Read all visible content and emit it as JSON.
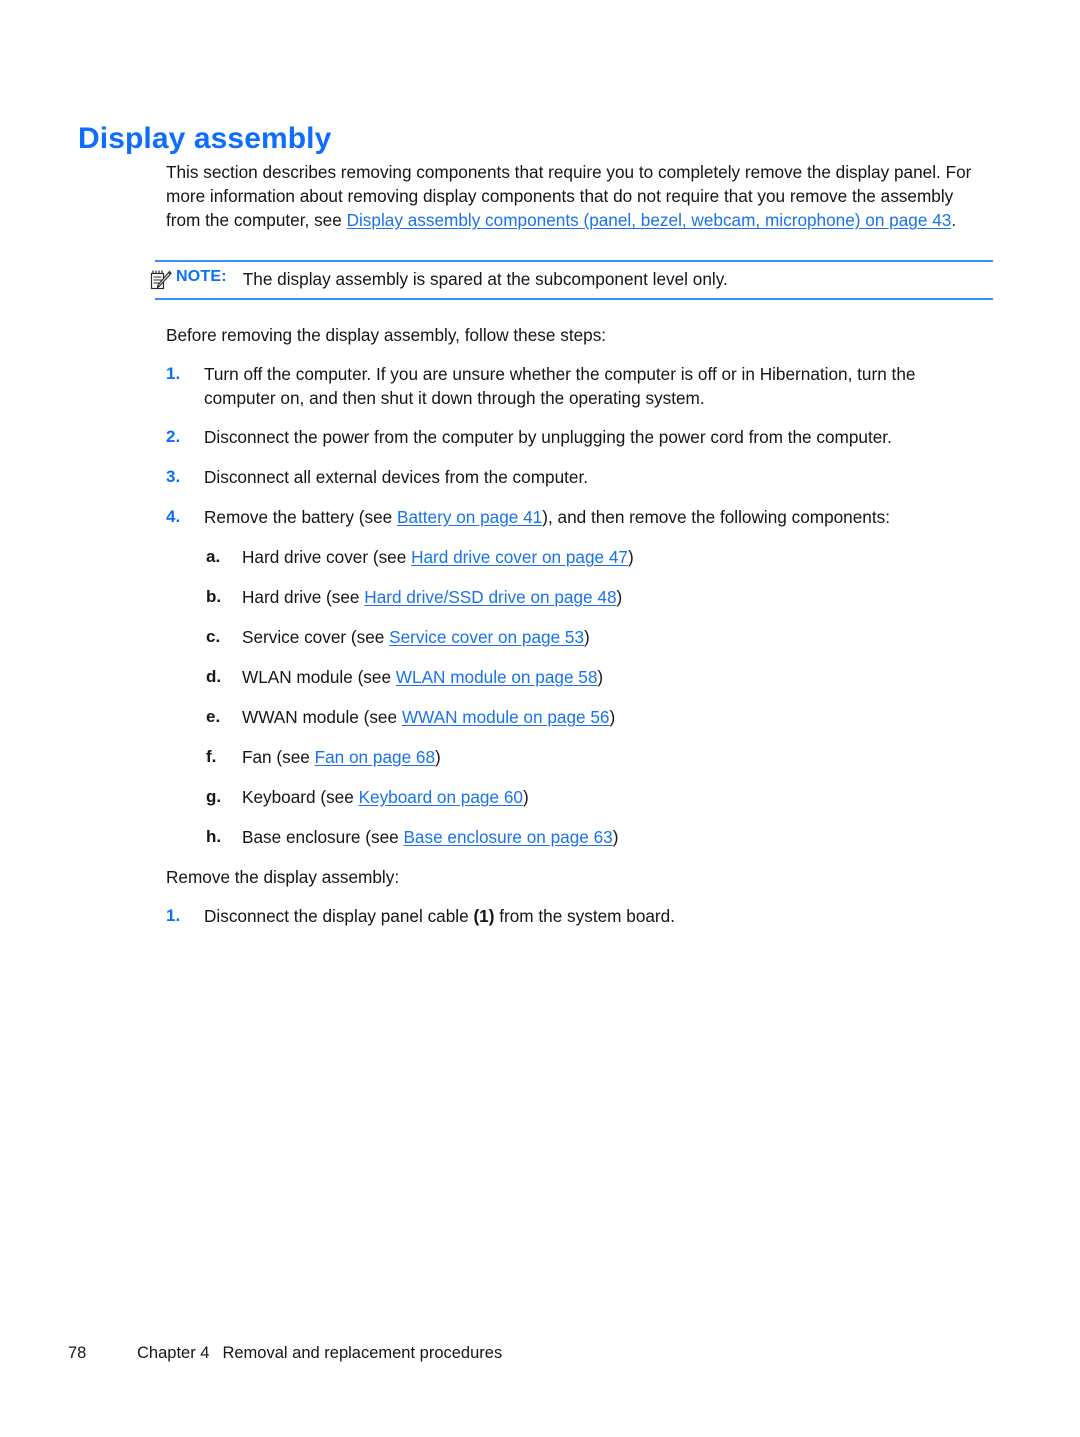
{
  "heading": "Display assembly",
  "colors": {
    "heading_blue": "#0d6efd",
    "link_blue": "#1a73e8",
    "rule_blue": "#3b8ef5",
    "body_black": "#161616"
  },
  "intro": {
    "text_part1": "This section describes removing components that require you to completely remove the display panel. For more information about removing display components that do not require that you remove the assembly from the computer, see ",
    "link": "Display assembly components (panel, bezel, webcam, microphone) on page 43",
    "text_part2": "."
  },
  "note": {
    "icon": "note-pencil-icon",
    "label": "NOTE:",
    "text": "The display assembly is spared at the subcomponent level only."
  },
  "before_lead": "Before removing the display assembly, follow these steps:",
  "steps": [
    {
      "num": "1.",
      "text": "Turn off the computer. If you are unsure whether the computer is off or in Hibernation, turn the computer on, and then shut it down through the operating system."
    },
    {
      "num": "2.",
      "text": "Disconnect the power from the computer by unplugging the power cord from the computer."
    },
    {
      "num": "3.",
      "text": "Disconnect all external devices from the computer."
    },
    {
      "num": "4.",
      "text_pre": "Remove the battery (see ",
      "link": "Battery on page 41",
      "text_post": "), and then remove the following components:"
    }
  ],
  "substeps": [
    {
      "letter": "a.",
      "text_pre": "Hard drive cover (see ",
      "link": "Hard drive cover on page 47",
      "text_post": ")"
    },
    {
      "letter": "b.",
      "text_pre": "Hard drive (see ",
      "link": "Hard drive/SSD drive on page 48",
      "text_post": ")"
    },
    {
      "letter": "c.",
      "text_pre": "Service cover (see ",
      "link": "Service cover on page 53",
      "text_post": ")"
    },
    {
      "letter": "d.",
      "text_pre": "WLAN module (see ",
      "link": "WLAN module on page 58",
      "text_post": ")"
    },
    {
      "letter": "e.",
      "text_pre": "WWAN module (see ",
      "link": "WWAN module on page 56",
      "text_post": ")"
    },
    {
      "letter": "f.",
      "text_pre": "Fan (see ",
      "link": "Fan on page 68",
      "text_post": ")"
    },
    {
      "letter": "g.",
      "text_pre": "Keyboard (see ",
      "link": "Keyboard on page 60",
      "text_post": ")"
    },
    {
      "letter": "h.",
      "text_pre": "Base enclosure (see ",
      "link": "Base enclosure on page 63",
      "text_post": ")"
    }
  ],
  "remove_lead": "Remove the display assembly:",
  "final_step": {
    "num": "1.",
    "text_pre": "Disconnect the display panel cable ",
    "callout": "(1)",
    "text_post": " from the system board."
  },
  "footer": {
    "page_number": "78",
    "chapter": "Chapter 4",
    "title": "Removal and replacement procedures"
  }
}
